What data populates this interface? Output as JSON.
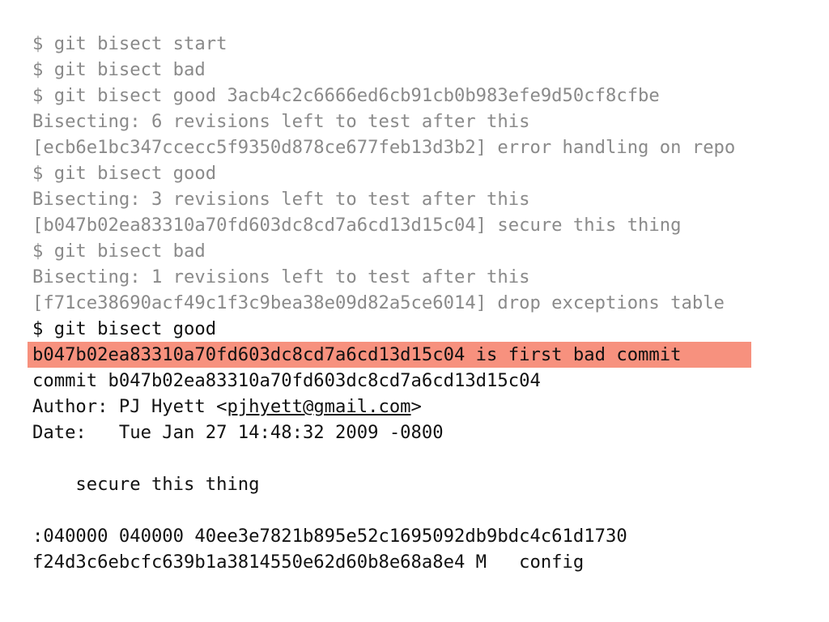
{
  "terminal": {
    "lines": [
      "$ git bisect start",
      "$ git bisect bad",
      "$ git bisect good 3acb4c2c6666ed6cb91cb0b983efe9d50cf8cfbe",
      "Bisecting: 6 revisions left to test after this",
      "[ecb6e1bc347ccecc5f9350d878ce677feb13d3b2] error handling on repo",
      "$ git bisect good",
      "Bisecting: 3 revisions left to test after this",
      "[b047b02ea83310a70fd603dc8cd7a6cd13d15c04] secure this thing",
      "$ git bisect bad",
      "Bisecting: 1 revisions left to test after this",
      "[f71ce38690acf49c1f3c9bea38e09d82a5ce6014] drop exceptions table",
      "$ git bisect good"
    ],
    "result_highlight": "b047b02ea83310a70fd603dc8cd7a6cd13d15c04 is first bad commit",
    "commit_line": "commit b047b02ea83310a70fd603dc8cd7a6cd13d15c04",
    "author_prefix": "Author: PJ Hyett <",
    "author_email": "pjhyett@gmail.com",
    "author_suffix": ">",
    "date_line": "Date:   Tue Jan 27 14:48:32 2009 -0800",
    "message_line": "    secure this thing",
    "diff_line_1": ":040000 040000 40ee3e7821b895e52c1695092db9bdc4c61d1730",
    "diff_line_2": "f24d3c6ebcfc639b1a3814550e62d60b8e68a8e4 M   config",
    "colors": {
      "dim_text": "#8a8a8a",
      "bright_text": "#111111",
      "highlight": "#f7917e",
      "background": "#ffffff"
    }
  }
}
